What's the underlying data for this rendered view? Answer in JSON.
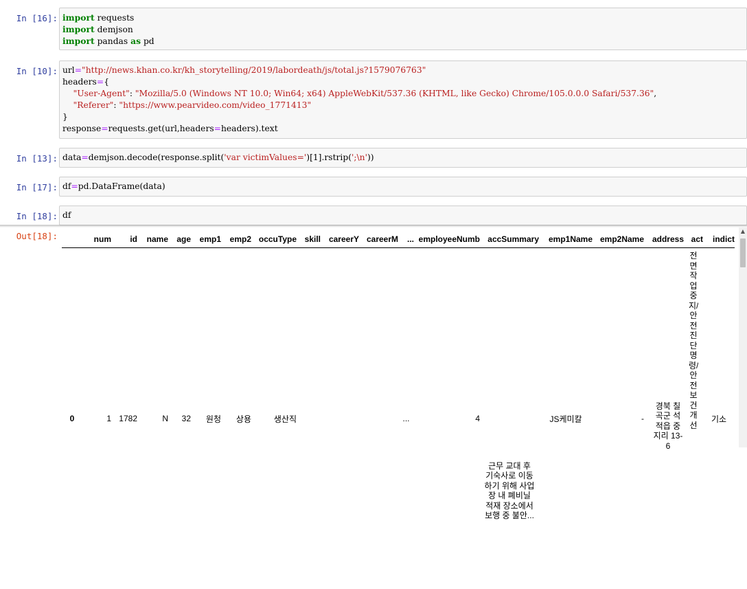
{
  "cells": [
    {
      "prompt": "In  [16]:",
      "lines": [
        [
          {
            "t": "import",
            "c": "kw"
          },
          {
            "t": " requests"
          }
        ],
        [
          {
            "t": "import",
            "c": "kw"
          },
          {
            "t": " demjson"
          }
        ],
        [
          {
            "t": "import",
            "c": "kw"
          },
          {
            "t": " pandas "
          },
          {
            "t": "as",
            "c": "kw"
          },
          {
            "t": " pd"
          }
        ]
      ]
    },
    {
      "prompt": "In  [10]:",
      "lines": [
        [
          {
            "t": "url"
          },
          {
            "t": "=",
            "c": "op"
          },
          {
            "t": "\"http://news.khan.co.kr/kh_storytelling/2019/labordeath/js/total.js?1579076763\"",
            "c": "str"
          }
        ],
        [
          {
            "t": "headers"
          },
          {
            "t": "=",
            "c": "op"
          },
          {
            "t": "{"
          }
        ],
        [
          {
            "t": "    "
          },
          {
            "t": "\"User-Agent\"",
            "c": "str"
          },
          {
            "t": ": "
          },
          {
            "t": "\"Mozilla/5.0 (Windows NT 10.0; Win64; x64) AppleWebKit/537.36 (KHTML, like Gecko) Chrome/105.0.0.0 Safari/537.36\"",
            "c": "str"
          },
          {
            "t": ","
          }
        ],
        [
          {
            "t": "    "
          },
          {
            "t": "\"Referer\"",
            "c": "str"
          },
          {
            "t": ": "
          },
          {
            "t": "\"https://www.pearvideo.com/video_1771413\"",
            "c": "str"
          }
        ],
        [
          {
            "t": "}"
          }
        ],
        [
          {
            "t": "response"
          },
          {
            "t": "=",
            "c": "op"
          },
          {
            "t": "requests.get(url,headers"
          },
          {
            "t": "=",
            "c": "op"
          },
          {
            "t": "headers).text"
          }
        ]
      ]
    },
    {
      "prompt": "In  [13]:",
      "lines": [
        [
          {
            "t": "data"
          },
          {
            "t": "=",
            "c": "op"
          },
          {
            "t": "demjson.decode(response.split("
          },
          {
            "t": "'var victimValues='",
            "c": "str"
          },
          {
            "t": ")[1].rstrip("
          },
          {
            "t": "';\\n'",
            "c": "str"
          },
          {
            "t": "))"
          }
        ]
      ]
    },
    {
      "prompt": "In  [17]:",
      "lines": [
        [
          {
            "t": "df"
          },
          {
            "t": "=",
            "c": "op"
          },
          {
            "t": "pd.DataFrame(data)"
          }
        ]
      ]
    },
    {
      "prompt": "In  [18]:",
      "lines": [
        [
          {
            "t": "df"
          }
        ]
      ]
    }
  ],
  "output": {
    "prompt": "Out[18]:",
    "columns": [
      "",
      "num",
      "id",
      "name",
      "age",
      "emp1",
      "emp2",
      "occuType",
      "skill",
      "careerY",
      "careerM",
      "...",
      "employeeNumb",
      "accSummary",
      "emp1Name",
      "emp2Name",
      "address",
      "act",
      "indict"
    ],
    "row": {
      "index": "0",
      "num": "1",
      "id": "1782",
      "name": "N",
      "age": "32",
      "emp1": "원청",
      "emp2": "상용",
      "occuType": "생산직",
      "skill": "",
      "careerY": "",
      "careerM": "",
      "ellipsis": "...",
      "employeeNumb": "4",
      "accSummary": "근무 교대 후 기숙사로 이동하기 위해 사업장 내 폐비닐 적재 장소에서 보행 중 불안...",
      "emp1Name": "JS케미칼",
      "emp2Name": "-",
      "address": "경북 칠곡군 석적읍 중지리 13-6",
      "act": "전면작업중지/안전진단명령/안전보건개선",
      "indict": "기소"
    }
  }
}
